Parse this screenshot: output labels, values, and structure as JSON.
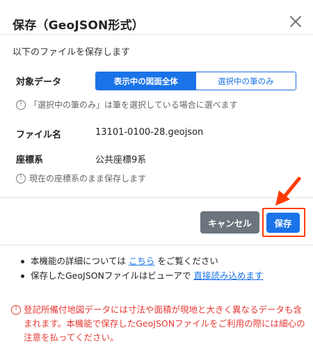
{
  "dialog": {
    "title": "保存（GeoJSON形式）",
    "intro": "以下のファイルを保存します"
  },
  "target": {
    "label": "対象データ",
    "options": [
      "表示中の図面全体",
      "選択中の筆のみ"
    ],
    "selected": "表示中の図面全体",
    "note": "「選択中の筆のみ」は筆を選択している場合に選べます"
  },
  "file": {
    "label": "ファイル名",
    "value": "13101-0100-28.geojson"
  },
  "crs": {
    "label": "座標系",
    "value": "公共座標9系",
    "note": "現在の座標系のまま保存します"
  },
  "buttons": {
    "cancel": "キャンセル",
    "save": "保存"
  },
  "info": {
    "line1_before": "本機能の詳細については",
    "line1_link": "こちら",
    "line1_after": "をご覧ください",
    "line2_before": "保存したGeoJSONファイルはビューアで",
    "line2_link": "直接読み込めます"
  },
  "warning": "登記所備付地図データには寸法や面積が現地と大きく異なるデータも含まれます。本機能で保存したGeoJSONファイルをご利用の際には細心の注意を払ってください。",
  "icons": {
    "close": "close-icon",
    "info": "info-circle-icon",
    "warning": "warning-circle-icon",
    "annotation": "red-arrow-icon"
  },
  "colors": {
    "primary": "#1a73e8",
    "cancel": "#6c757d",
    "warning": "#e53935",
    "annotation": "#ff3b00"
  }
}
